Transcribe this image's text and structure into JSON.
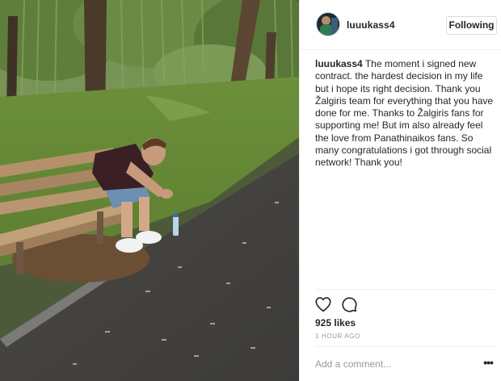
{
  "post": {
    "username": "luuukass4",
    "follow_label": "Following",
    "caption_user": "luuukass4",
    "caption_text": " The moment i signed new contract. the hardest decision in my life but i hope its right decision. Thank you Žalgiris team for everything that you have done for me. Thanks to Žalgiris fans for supporting me! But im also already feel the love from Panathinaikos fans. So many congratulations i got through social network! Thank you!",
    "likes": "925 likes",
    "time_ago": "1 HOUR AGO",
    "comment_placeholder": "Add a comment...",
    "more_label": "•••"
  },
  "icons": {
    "like": "heart-icon",
    "comment": "speech-bubble-icon",
    "more": "more-options-icon"
  },
  "colors": {
    "text": "#262626",
    "muted": "#999999",
    "border": "#dbdbdb"
  }
}
